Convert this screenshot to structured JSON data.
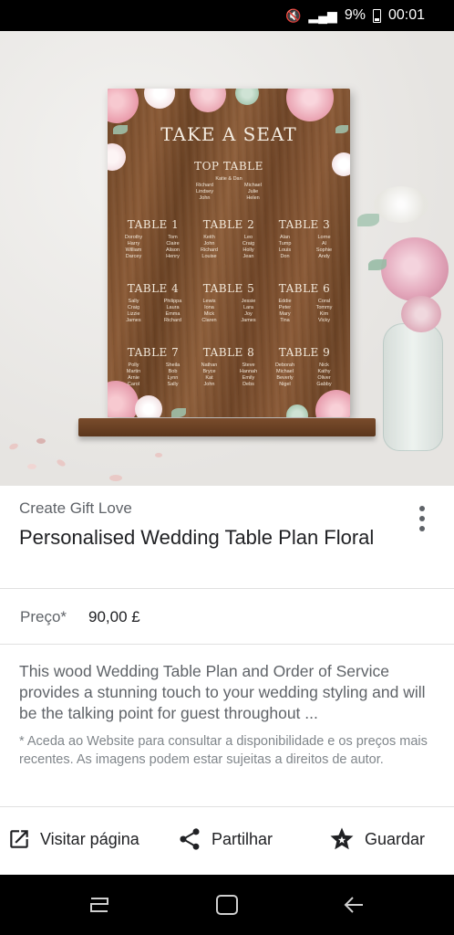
{
  "status_bar": {
    "battery": "9%",
    "time": "00:01"
  },
  "sign": {
    "title": "TAKE A SEAT",
    "top_table": {
      "name": "TOP TABLE",
      "names": [
        "Katie & Dan",
        "Richard",
        "Michael",
        "Lindsey",
        "Julie",
        "John",
        "Helen"
      ]
    },
    "tables": [
      {
        "name": "TABLE 1",
        "names": [
          "Dorothy",
          "Tom",
          "Harry",
          "Claire",
          "William",
          "Alison",
          "Darcey",
          "Henry"
        ]
      },
      {
        "name": "TABLE 2",
        "names": [
          "Keith",
          "Leo",
          "John",
          "Craig",
          "Richard",
          "Holly",
          "Louise",
          "Jean"
        ]
      },
      {
        "name": "TABLE 3",
        "names": [
          "Alan",
          "Lorne",
          "Tump",
          "Al",
          "Louis",
          "Sophie",
          "Don",
          "Andy"
        ]
      },
      {
        "name": "TABLE 4",
        "names": [
          "Sally",
          "Philippa",
          "Craig",
          "Laura",
          "Lizzie",
          "Emma",
          "James",
          "Richard"
        ]
      },
      {
        "name": "TABLE 5",
        "names": [
          "Lewis",
          "Jessie",
          "Iona",
          "Lara",
          "Mick",
          "Joy",
          "Claren",
          "James"
        ]
      },
      {
        "name": "TABLE 6",
        "names": [
          "Eddie",
          "Coral",
          "Peter",
          "Tommy",
          "Mary",
          "Kim",
          "Tina",
          "Vicky"
        ]
      },
      {
        "name": "TABLE 7",
        "names": [
          "Polly",
          "Sheila",
          "Martin",
          "Bob",
          "Arnie",
          "Lynn",
          "Carol",
          "Sally"
        ]
      },
      {
        "name": "TABLE 8",
        "names": [
          "Nathan",
          "Steve",
          "Bryce",
          "Hannah",
          "Kat",
          "Emily",
          "John",
          "Debs"
        ]
      },
      {
        "name": "TABLE 9",
        "names": [
          "Deborah",
          "Nick",
          "Michael",
          "Kathy",
          "Beverly",
          "Oliver",
          "Nigel",
          "Gabby"
        ]
      }
    ]
  },
  "product": {
    "source": "Create Gift Love",
    "title": "Personalised Wedding Table Plan Floral",
    "price_label": "Preço*",
    "price_value": "90,00 £",
    "description": "This wood Wedding Table Plan and Order of Service provides a stunning touch to your wedding styling and will be the talking point for guest throughout ...",
    "disclaimer": "* Aceda ao Website para consultar a disponibilidade e os preços mais recentes. As imagens podem estar sujeitas a direitos de autor."
  },
  "actions": {
    "visit": "Visitar página",
    "share": "Partilhar",
    "save": "Guardar"
  },
  "icons": {
    "visit": "open-in-new-icon",
    "share": "share-icon",
    "save": "star-icon",
    "more": "more-vert-icon"
  }
}
